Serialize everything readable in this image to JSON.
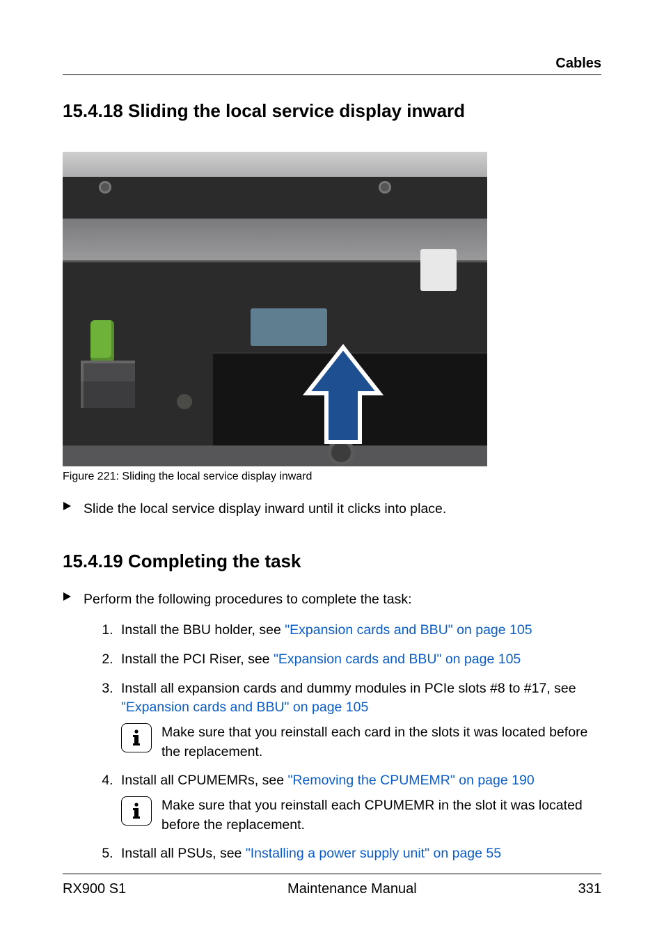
{
  "header": {
    "category": "Cables"
  },
  "section1": {
    "number": "15.4.18",
    "title": "Sliding the local service display inward",
    "figure": {
      "number": "221",
      "caption": "Sliding the local service display inward"
    },
    "bullet": "Slide the local service display inward until it clicks into place."
  },
  "section2": {
    "number": "15.4.19",
    "title": "Completing the task",
    "lead": "Perform the following procedures to complete the task:",
    "steps": [
      {
        "pre": "Install the BBU holder, see ",
        "link": "\"Expansion cards and BBU\" on page 105",
        "post": ""
      },
      {
        "pre": "Install the PCI Riser, see ",
        "link": "\"Expansion cards and BBU\" on page 105",
        "post": ""
      },
      {
        "pre": "Install all expansion cards and dummy modules in PCIe slots #8 to #17, see ",
        "link": "\"Expansion cards and BBU\" on page 105",
        "post": "",
        "note": "Make sure that you reinstall each card in the slots it was located before the replacement."
      },
      {
        "pre": "Install all CPUMEMRs, see ",
        "link": "\"Removing the CPUMEMR\" on page 190",
        "post": "",
        "note": "Make sure that you reinstall each CPUMEMR in the slot it was located before the replacement."
      },
      {
        "pre": "Install all PSUs, see ",
        "link": "\"Installing a power supply unit\" on page 55",
        "post": ""
      }
    ]
  },
  "footer": {
    "left": "RX900 S1",
    "center": "Maintenance Manual",
    "right": "331"
  },
  "icons": {
    "info": "i"
  }
}
